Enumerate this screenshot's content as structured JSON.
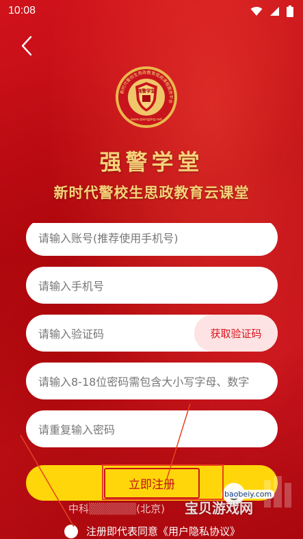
{
  "status_bar": {
    "time": "10:08",
    "icons": [
      "wifi-icon",
      "signal-icon",
      "battery-icon"
    ]
  },
  "header": {
    "back_icon": "chevron-left-icon",
    "logo_icon": "police-academy-emblem-icon",
    "logo_ring_text": "新时代警校生思政教育视频课程服务平台",
    "logo_center_text": "强警学堂",
    "logo_url_text": "www.qiangjing.net",
    "title": "强警学堂",
    "subtitle": "新时代警校生思政教育云课堂"
  },
  "form": {
    "account_placeholder": "请输入账号(推荐使用手机号)",
    "phone_placeholder": "请输入手机号",
    "code_placeholder": "请输入验证码",
    "get_code_label": "获取验证码",
    "password_placeholder": "请输入8-18位密码需包含大小写字母、数字",
    "confirm_password_placeholder": "请重复输入密码",
    "register_label": "立即注册"
  },
  "footer": {
    "company_text": "中科",
    "company_text_tail": "(北京)",
    "agreement_text": "注册即代表同意《用户隐私协议》"
  },
  "watermark": {
    "title": "宝贝游戏网",
    "url": "baobeiy.com"
  },
  "colors": {
    "background": "#c8141c",
    "accent_gold": "#f6d27a",
    "button_yellow": "#ffd60a",
    "code_button_bg": "#fde3e3",
    "code_button_text": "#d8121b"
  }
}
